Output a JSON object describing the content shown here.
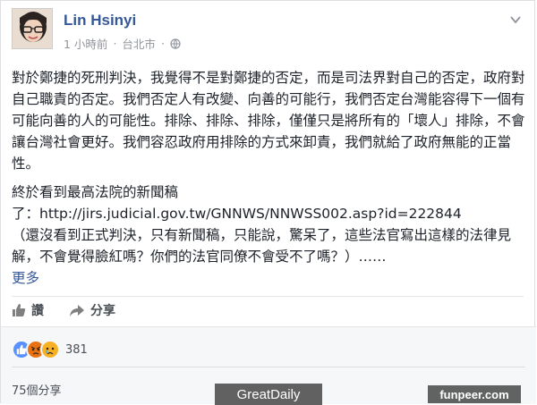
{
  "post": {
    "author": "Lin Hsinyi",
    "time": "1 小時前",
    "location": "台北市",
    "separator": "·",
    "paragraph1": "對於鄭捷的死刑判決，我覺得不是對鄭捷的否定，而是司法界對自己的否定，政府對自己職責的否定。我們否定人有改變、向善的可能行，我們否定台灣能容得下一個有可能向善的人的可能性。排除、排除、排除，僅僅只是將所有的「壞人」排除，不會讓台灣社會更好。我們容忍政府用排除的方式來卸責，我們就給了政府無能的正當性。",
    "paragraph2_title": "終於看到最高法院的新聞稿",
    "paragraph2_link_prefix": "了：",
    "paragraph2_link": "http://jirs.judicial.gov.tw/GNNWS/NNWSS002.asp?id=222844",
    "paragraph2_body": "（還沒看到正式判決，只有新聞稿，只能說，驚呆了，這些法官寫出這樣的法律見解，不會覺得臉紅嗎？你們的法官同僚不會受不了嗎？）……",
    "more_label": "更多"
  },
  "actions": {
    "like_label": "讚",
    "share_label": "分享"
  },
  "stats": {
    "reactions_count": "381",
    "shares": "75個分享",
    "reaction_icons": [
      "like-icon",
      "angry-icon",
      "sad-icon"
    ]
  },
  "colors": {
    "author": "#365899",
    "like_blue": "#5890ff",
    "angry": "#e9710f",
    "sad": "#f7b125"
  },
  "watermarks": {
    "greatdaily": "GreatDaily",
    "funpeer": "funpeer.com"
  }
}
